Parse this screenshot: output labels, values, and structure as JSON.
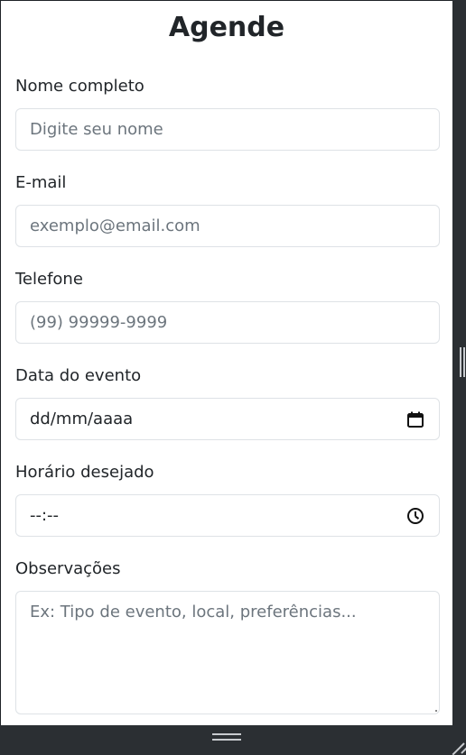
{
  "form": {
    "title": "Agende",
    "fields": {
      "name": {
        "label": "Nome completo",
        "placeholder": "Digite seu nome"
      },
      "email": {
        "label": "E-mail",
        "placeholder": "exemplo@email.com"
      },
      "phone": {
        "label": "Telefone",
        "placeholder": "(99) 99999-9999"
      },
      "date": {
        "label": "Data do evento",
        "value": "dd/mm/aaaa",
        "icon": "calendar-icon"
      },
      "time": {
        "label": "Horário desejado",
        "value": "--:--",
        "icon": "clock-icon"
      },
      "notes": {
        "label": "Observações",
        "placeholder": "Ex: Tipo de evento, local, preferências..."
      }
    }
  },
  "colors": {
    "text": "#212529",
    "placeholder": "#6c757d",
    "border": "#dee2e6",
    "frame": "#2b2f33"
  }
}
